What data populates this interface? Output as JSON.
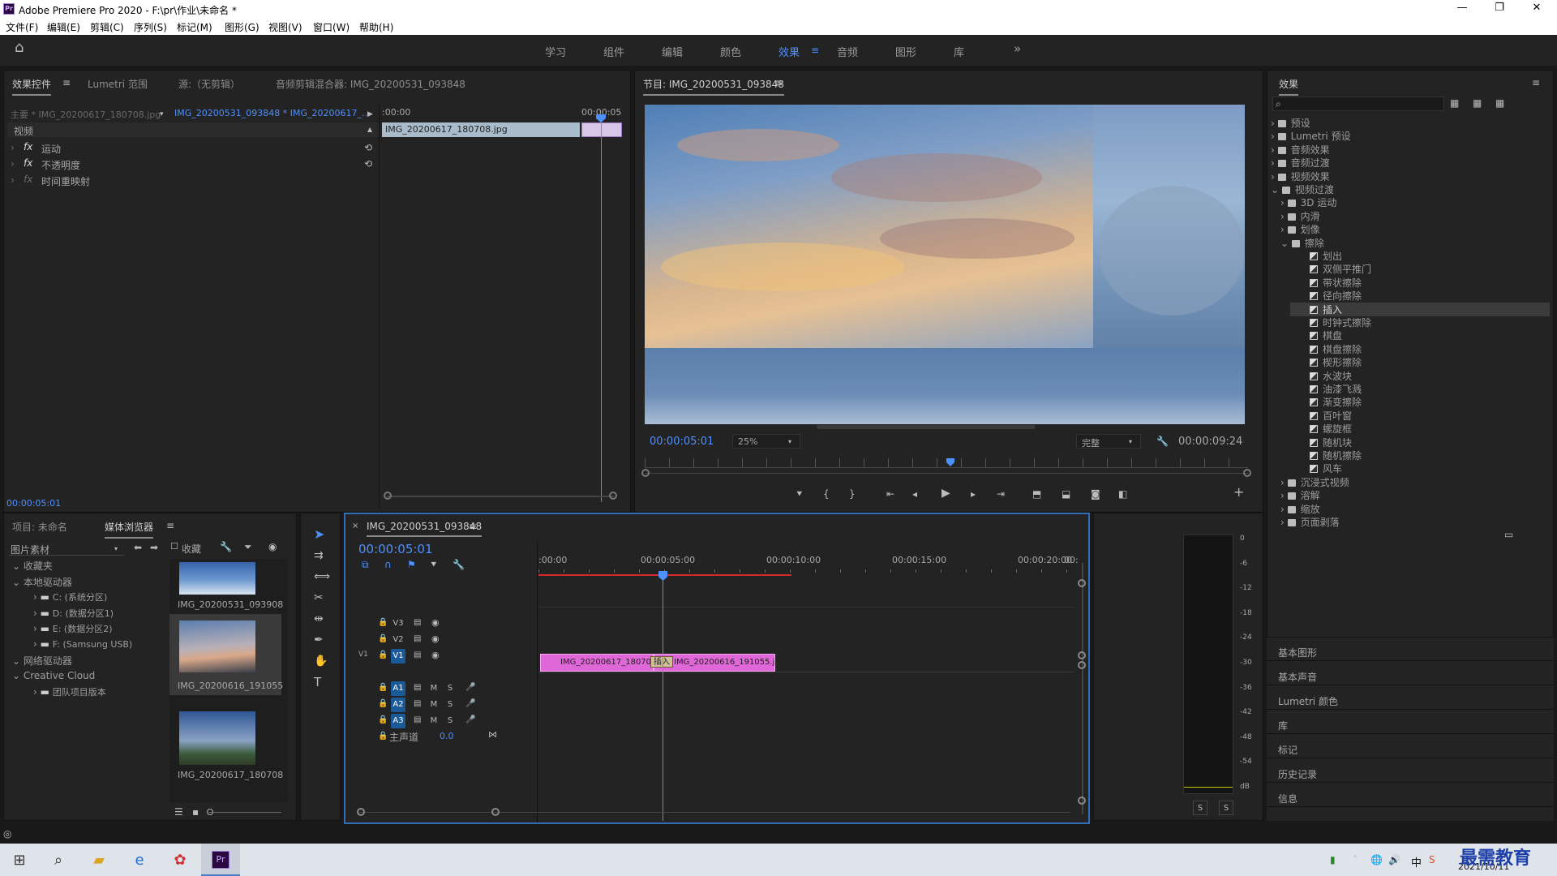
{
  "window": {
    "title": "Adobe Premiere Pro 2020 - F:\\pr\\作业\\未命名 *",
    "logo": "Pr",
    "controls": [
      "—",
      "❐",
      "✕"
    ]
  },
  "menu": [
    "文件(F)",
    "编辑(E)",
    "剪辑(C)",
    "序列(S)",
    "标记(M)",
    "图形(G)",
    "视图(V)",
    "窗口(W)",
    "帮助(H)"
  ],
  "workspaces": {
    "items": [
      "学习",
      "组件",
      "编辑",
      "颜色",
      "效果",
      "音频",
      "图形",
      "库"
    ],
    "active": "效果",
    "more": "»"
  },
  "effect_controls": {
    "tabs": [
      "效果控件",
      "Lumetri 范围",
      "源:（无剪辑）",
      "音频剪辑混合器: IMG_20200531_093848"
    ],
    "master": "主要 * IMG_20200617_180708.jpg",
    "sequence": "IMG_20200531_093848 * IMG_20200617_...",
    "time_start": ":00:00",
    "time_end": "00:00:05",
    "clip_name": "IMG_20200617_180708.jpg",
    "section": "视频",
    "props": [
      "运动",
      "不透明度",
      "时间重映射"
    ],
    "fx_label": "fx",
    "timecode": "00:00:05:01"
  },
  "program": {
    "title": "节目: IMG_20200531_093848",
    "timecode": "00:00:05:01",
    "zoom": "25%",
    "quality": "完整",
    "duration": "00:00:09:24"
  },
  "effects_panel": {
    "title": "效果",
    "search_placeholder": "",
    "top_folders": [
      "预设",
      "Lumetri 预设",
      "音频效果",
      "音频过渡",
      "视频效果",
      "视频过渡"
    ],
    "sub_folders": [
      "3D 运动",
      "内滑",
      "划像",
      "擦除"
    ],
    "wipes": [
      "划出",
      "双侧平推门",
      "带状擦除",
      "径向擦除",
      "插入",
      "时钟式擦除",
      "棋盘",
      "棋盘擦除",
      "楔形擦除",
      "水波块",
      "油漆飞溅",
      "渐变擦除",
      "百叶窗",
      "螺旋框",
      "随机块",
      "随机擦除",
      "风车"
    ],
    "selected": "插入",
    "more_folders": [
      "沉浸式视频",
      "溶解",
      "缩放",
      "页面剥落"
    ],
    "bottom_sections": [
      "基本图形",
      "基本声音",
      "Lumetri 颜色",
      "库",
      "标记",
      "历史记录",
      "信息"
    ]
  },
  "project": {
    "tabs": [
      "项目: 未命名",
      "媒体浏览器"
    ],
    "filter": "图片素材",
    "collect": "收藏",
    "tree": [
      {
        "label": "收藏夹",
        "indent": 0,
        "open": true
      },
      {
        "label": "本地驱动器",
        "indent": 0,
        "open": true
      },
      {
        "label": "C: (系统分区)",
        "indent": 1
      },
      {
        "label": "D: (数据分区1)",
        "indent": 1
      },
      {
        "label": "E: (数据分区2)",
        "indent": 1
      },
      {
        "label": "F: (Samsung USB)",
        "indent": 1
      },
      {
        "label": "网络驱动器",
        "indent": 0,
        "open": true
      },
      {
        "label": "Creative Cloud",
        "indent": 0,
        "open": true
      },
      {
        "label": "团队项目版本",
        "indent": 1
      }
    ],
    "thumbs": [
      "IMG_20200531_093908",
      "IMG_20200616_191055",
      "IMG_20200617_180708"
    ]
  },
  "timeline": {
    "seq_name": "IMG_20200531_093848",
    "timecode": "00:00:05:01",
    "ruler": [
      ":00:00",
      "00:00:05:00",
      "00:00:10:00",
      "00:00:15:00",
      "00:00:20:00",
      "00:"
    ],
    "video_tracks": [
      "V3",
      "V2",
      "V1"
    ],
    "audio_tracks": [
      "A1",
      "A2",
      "A3"
    ],
    "master": "主声道",
    "master_val": "0.0",
    "clip1": "IMG_20200617_180708.j",
    "clip2": "IMG_20200616_191055.j",
    "transition": "插入",
    "m": "M",
    "s": "S"
  },
  "meter": {
    "scale": [
      "0",
      "-6",
      "-12",
      "-18",
      "-24",
      "-30",
      "-36",
      "-42",
      "-48",
      "-54",
      "dB"
    ],
    "solo": [
      "S",
      "S"
    ]
  },
  "taskbar": {
    "time": "2021/10/11",
    "ime": "中",
    "watermark": "最需教育"
  },
  "colors": {
    "accent": "#4d90fe",
    "clip": "#e067d8",
    "panel": "#232323",
    "selected": "#3b3b3b"
  }
}
